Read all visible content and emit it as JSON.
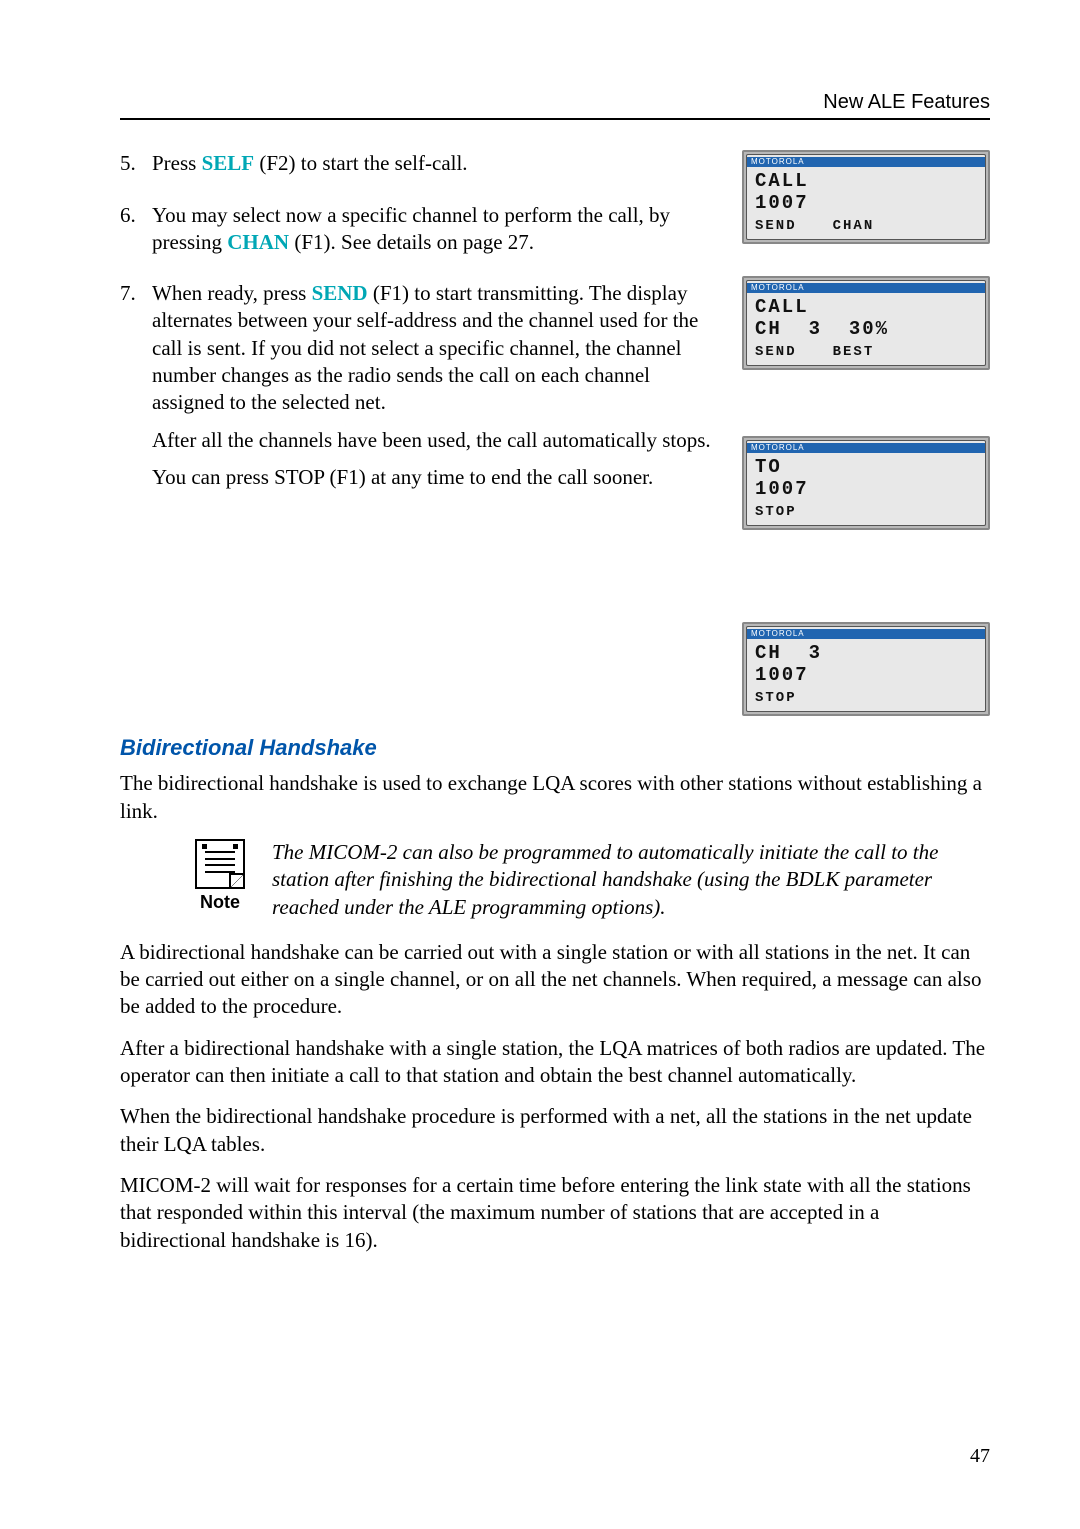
{
  "header": {
    "title": "New ALE Features"
  },
  "steps": [
    {
      "num": "5.",
      "parts": [
        {
          "runs": [
            {
              "t": "Press "
            },
            {
              "t": "SELF",
              "cls": "softkey"
            },
            {
              "t": " (F2) to start the self-call."
            }
          ]
        }
      ]
    },
    {
      "num": "6.",
      "parts": [
        {
          "runs": [
            {
              "t": "You may select now a specific channel to perform the call, by pressing "
            },
            {
              "t": "CHAN",
              "cls": "softkey"
            },
            {
              "t": " ​(F1). See details on page 27."
            }
          ]
        }
      ]
    },
    {
      "num": "7.",
      "parts": [
        {
          "runs": [
            {
              "t": "When ready, press "
            },
            {
              "t": "SEND",
              "cls": "softkey"
            },
            {
              "t": " (F1) to start transmitting. The display alternates between your self-address and the channel used for the call is sent. If you did not select a specific channel, the channel number changes as the radio sends the call on each channel assigned to the selected net."
            }
          ]
        },
        {
          "runs": [
            {
              "t": "After all the channels have been used, the call automatically stops."
            }
          ]
        },
        {
          "runs": [
            {
              "t": "You can press STOP (F1) at any time to end the call sooner."
            }
          ]
        }
      ]
    }
  ],
  "section_title": "Bidirectional Handshake",
  "paras": [
    "The bidirectional handshake is used to exchange LQA scores with other stations without establishing a link.",
    "A bidirectional handshake can be carried out with a single station or with all stations in the net. It can be carried out either on a single channel, or on all the net channels. When required, a message can also be added to the procedure.",
    "After a bidirectional handshake with a single station, the LQA matrices of both radios are updated. The operator can then initiate a call to that station and obtain the best channel automatically.",
    "When the bidirectional handshake procedure is performed with a net, all the stations in the net update their LQA tables.",
    "MICOM-2 will wait for responses for a certain time before entering the link state with all the stations that responded within this interval (the maximum number of stations that are accepted in a bidirectional handshake is 16)."
  ],
  "note": {
    "label": "Note",
    "text": "The MICOM-2 can also be programmed to automatically initiate the call to the station after finishing the bidirectional handshake (using the BDLK parameter reached under the ALE programming options)."
  },
  "lcds": [
    {
      "brand": "MOTOROLA",
      "lines": [
        "CALL",
        "1007"
      ],
      "soft": [
        "SEND",
        "CHAN"
      ]
    },
    {
      "brand": "MOTOROLA",
      "lines": [
        "CALL",
        "CH  3  30%"
      ],
      "soft": [
        "SEND",
        "BEST"
      ]
    },
    {
      "brand": "MOTOROLA",
      "lines": [
        "TO",
        "1007"
      ],
      "soft": [
        "STOP"
      ]
    },
    {
      "brand": "MOTOROLA",
      "lines": [
        "CH  3",
        "1007"
      ],
      "soft": [
        "STOP"
      ]
    }
  ],
  "page_number": "47"
}
